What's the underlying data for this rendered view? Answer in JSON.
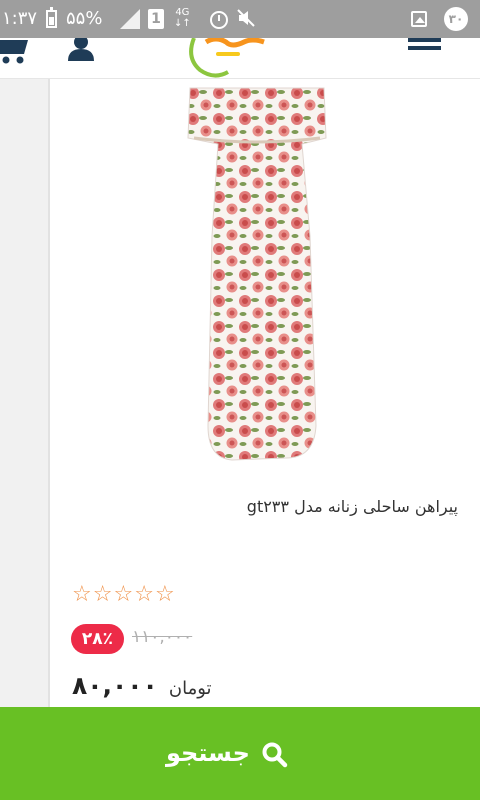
{
  "status_bar": {
    "time": "۱:۳۷",
    "battery": "۵۵%",
    "sim": "1",
    "network_top": "4G",
    "network_bottom": "↓↑",
    "notification_count": "۳۰"
  },
  "header": {
    "icons": [
      "cart-icon",
      "user-icon",
      "logo",
      "menu-icon"
    ]
  },
  "product": {
    "title": "پیراهن ساحلی زنانه مدل gt۲۳۳",
    "rating_stars": 0,
    "rating_max": 5,
    "star_glyph": "☆",
    "discount": "۲۸٪",
    "old_price": "۱۱۰,۰۰۰",
    "price": "۸۰,۰۰۰",
    "currency": "تومان"
  },
  "search_bar": {
    "label": "جستجو"
  },
  "colors": {
    "status_bar": "#9e9e9e",
    "accent_green": "#68c024",
    "discount_red": "#ed2b48",
    "star": "#f0934c",
    "menu": "#1f3c57"
  }
}
